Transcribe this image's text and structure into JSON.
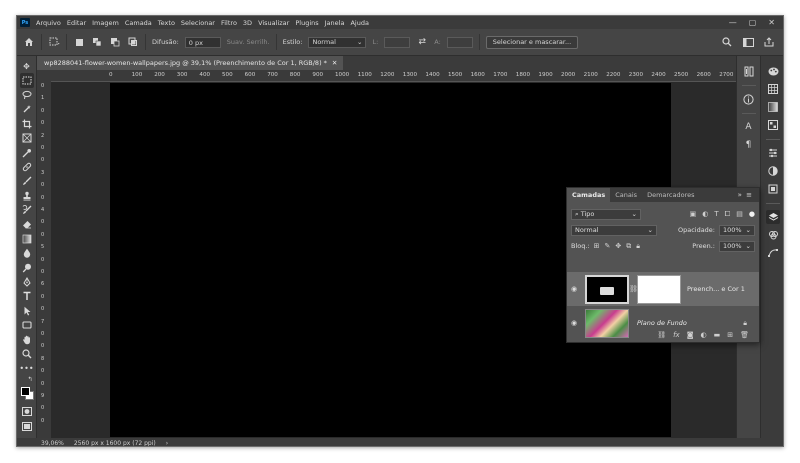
{
  "app": {
    "logo": "Ps"
  },
  "menubar": {
    "items": [
      "Arquivo",
      "Editar",
      "Imagem",
      "Camada",
      "Texto",
      "Selecionar",
      "Filtro",
      "3D",
      "Visualizar",
      "Plugins",
      "Janela",
      "Ajuda"
    ],
    "window_controls": [
      "—",
      "▢",
      "✕"
    ]
  },
  "options_bar": {
    "home_icon": "home-icon",
    "feather_label": "Difusão:",
    "feather_value": "0 px",
    "antialias_label": "Suav. Serrilh.",
    "style_label": "Estilo:",
    "style_value": "Normal",
    "width_label": "L:",
    "height_label": "A:",
    "select_mask_button": "Selecionar e mascarar..."
  },
  "document": {
    "tab_title": "wp8288041-flower-women-wallpapers.jpg @ 39,1% (Preenchimento de Cor 1, RGB/8) *",
    "close_glyph": "✕",
    "canvas_color": "#000000"
  },
  "ruler": {
    "h_ticks": [
      "0",
      "50",
      "100",
      "150",
      "200",
      "250",
      "300",
      "350",
      "400",
      "450",
      "500",
      "550",
      "600",
      "650",
      "700",
      "750",
      "800",
      "850",
      "900",
      "950",
      "1000",
      "1050",
      "1100",
      "1150",
      "1200",
      "1250",
      "1300",
      "1350",
      "1400",
      "1450",
      "1500",
      "1550",
      "1600",
      "1650",
      "1700",
      "1750",
      "1800",
      "1850",
      "1900",
      "1950",
      "2000",
      "2050",
      "2100",
      "2150",
      "2200",
      "2250",
      "2300",
      "2350",
      "2400",
      "2450",
      "2500",
      "2550",
      "2600",
      "2650",
      "2700",
      "2750"
    ],
    "v_ticks": [
      "0",
      "1",
      "0",
      "0",
      "2",
      "0",
      "0",
      "3",
      "0",
      "0",
      "4",
      "0",
      "0",
      "5",
      "0",
      "0",
      "6",
      "0",
      "0",
      "7",
      "0",
      "0",
      "8",
      "0",
      "0",
      "9",
      "0",
      "0"
    ]
  },
  "status_bar": {
    "zoom": "39,06%",
    "doc_info": "2560 px x 1600 px (72 ppi)",
    "arrow": "›"
  },
  "layers_panel": {
    "tabs": [
      "Camadas",
      "Canais",
      "Demarcadores"
    ],
    "menu_glyph": "»  ≡",
    "filter_kind": "Tipo",
    "blend_mode": "Normal",
    "opacity_label": "Opacidade:",
    "opacity_value": "100%",
    "lock_label": "Bloq.:",
    "fill_label": "Preen.:",
    "fill_value": "100%",
    "layers": [
      {
        "name": "Preench... e Cor 1",
        "selected": true
      },
      {
        "name": "Plano de Fundo",
        "locked": true
      }
    ]
  },
  "colors": {
    "foreground": "#000000",
    "background": "#ffffff",
    "accent": "#31a8ff"
  }
}
